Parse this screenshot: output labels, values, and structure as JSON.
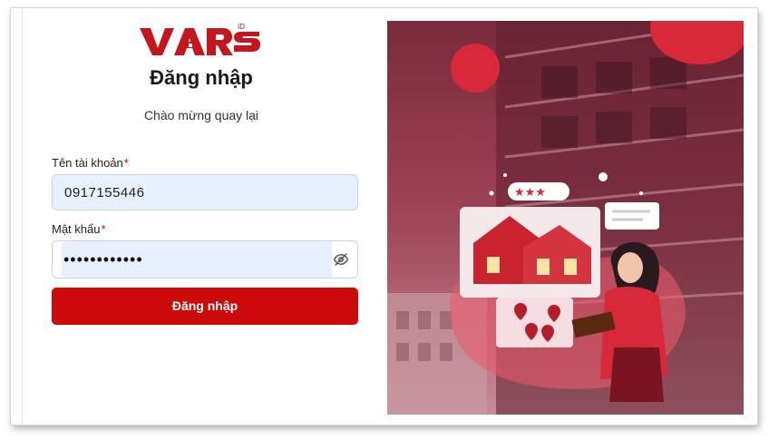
{
  "brand": {
    "logo_text": "VARS",
    "logo_sup": "ID",
    "color": "#cc0a0a"
  },
  "login": {
    "title": "Đăng nhập",
    "subtitle": "Chào mừng quay lại",
    "username_label": "Tên tài khoản",
    "username_value": "0917155446",
    "password_label": "Mật khẩu",
    "password_value": "••••••••••••",
    "required_mark": "*",
    "submit_label": "Đăng nhập"
  },
  "icons": {
    "password_toggle": "eye-off-icon"
  }
}
